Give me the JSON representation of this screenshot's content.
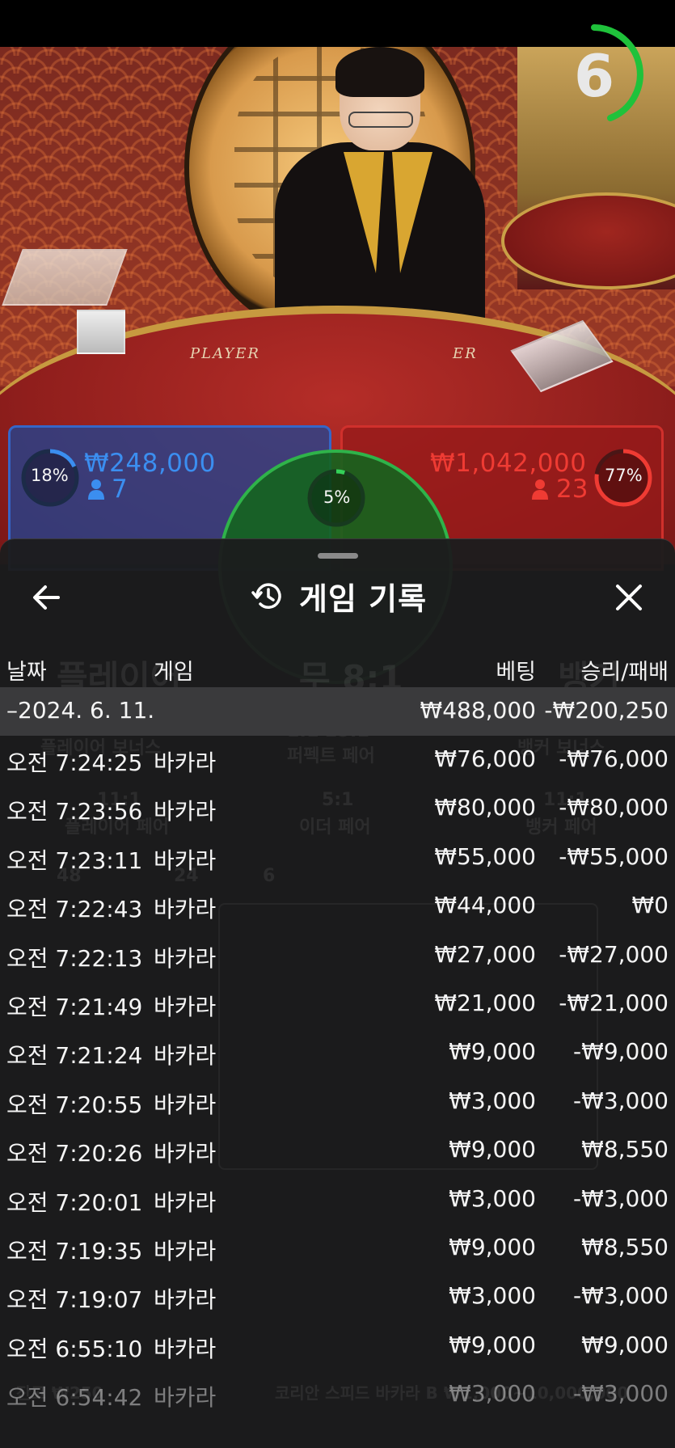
{
  "video": {
    "timer": "6",
    "table_label_player": "PLAYER",
    "table_label_banker": "ER"
  },
  "bets": {
    "player": {
      "percent": "18%",
      "amount": "₩248,000",
      "count": "7",
      "ring_fraction": 0.18
    },
    "tie": {
      "percent": "5%",
      "ring_fraction": 0.05
    },
    "banker": {
      "percent": "77%",
      "amount": "₩1,042,000",
      "count": "23",
      "ring_fraction": 0.77
    }
  },
  "colors": {
    "player": "#3b8ef0",
    "banker": "#ef3b33",
    "tie": "#34d058"
  },
  "history": {
    "title": "게임 기록",
    "icons": {
      "back": "arrow-left-icon",
      "history": "history-clock-icon",
      "close": "close-x-icon",
      "user": "user-icon"
    },
    "columns": {
      "date": "날짜",
      "game": "게임",
      "bet": "베팅",
      "result": "승리/패배"
    },
    "date_group": {
      "date": "–2024. 6. 11.",
      "bet": "₩488,000",
      "result": "-₩200,250"
    },
    "rows": [
      {
        "time": "오전 7:24:25",
        "game": "바카라",
        "bet": "₩76,000",
        "result": "-₩76,000"
      },
      {
        "time": "오전 7:23:56",
        "game": "바카라",
        "bet": "₩80,000",
        "result": "-₩80,000"
      },
      {
        "time": "오전 7:23:11",
        "game": "바카라",
        "bet": "₩55,000",
        "result": "-₩55,000"
      },
      {
        "time": "오전 7:22:43",
        "game": "바카라",
        "bet": "₩44,000",
        "result": "₩0"
      },
      {
        "time": "오전 7:22:13",
        "game": "바카라",
        "bet": "₩27,000",
        "result": "-₩27,000"
      },
      {
        "time": "오전 7:21:49",
        "game": "바카라",
        "bet": "₩21,000",
        "result": "-₩21,000"
      },
      {
        "time": "오전 7:21:24",
        "game": "바카라",
        "bet": "₩9,000",
        "result": "-₩9,000"
      },
      {
        "time": "오전 7:20:55",
        "game": "바카라",
        "bet": "₩3,000",
        "result": "-₩3,000"
      },
      {
        "time": "오전 7:20:26",
        "game": "바카라",
        "bet": "₩9,000",
        "result": "₩8,550"
      },
      {
        "time": "오전 7:20:01",
        "game": "바카라",
        "bet": "₩3,000",
        "result": "-₩3,000"
      },
      {
        "time": "오전 7:19:35",
        "game": "바카라",
        "bet": "₩9,000",
        "result": "₩8,550"
      },
      {
        "time": "오전 7:19:07",
        "game": "바카라",
        "bet": "₩3,000",
        "result": "-₩3,000"
      },
      {
        "time": "오전 6:55:10",
        "game": "바카라",
        "bet": "₩9,000",
        "result": "₩9,000"
      },
      {
        "time": "오전 6:54:42",
        "game": "바카라",
        "bet": "₩3,000",
        "result": "-₩3,000"
      }
    ]
  },
  "background_ghost": {
    "player_area": "플레이어",
    "tie_area": "무 8:1",
    "banker_area": "뱅커",
    "player_bonus": "플레이어 보너스",
    "perfect_pair": "퍼펙트 페어",
    "perfect_pair_odds": "1:1 25:1",
    "banker_bonus": "뱅커 보너스",
    "either_pair": "이더 페어",
    "either_pair_odds": "5:1",
    "banker_pair_odds": "11:1",
    "banker_pair": "뱅커 페어",
    "player_pair_odds": "11:1",
    "player_pair": "플레이어 페어",
    "stat_player": "48",
    "stat_banker": "24",
    "stat_tie": "6",
    "footer_table": "코리안 스피드 바카라 B ₩1,000~10,000,000",
    "footer_balance": "잔고 ₩250"
  }
}
